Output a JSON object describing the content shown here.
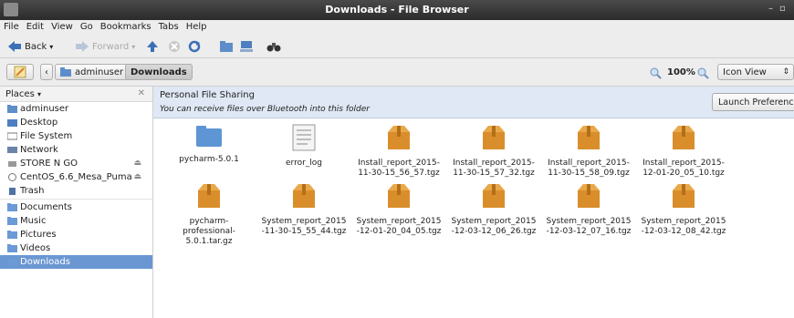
{
  "window": {
    "title": "Downloads - File Browser"
  },
  "menu": [
    "File",
    "Edit",
    "View",
    "Go",
    "Bookmarks",
    "Tabs",
    "Help"
  ],
  "toolbar": {
    "back": "Back",
    "forward": "Forward"
  },
  "location": {
    "crumbs": [
      "adminuser",
      "Downloads"
    ],
    "zoom": "100%",
    "view_mode": "Icon View"
  },
  "sidebar": {
    "header": "Places",
    "places": [
      {
        "label": "adminuser",
        "icon": "home-folder"
      },
      {
        "label": "Desktop",
        "icon": "desktop-folder"
      },
      {
        "label": "File System",
        "icon": "filesystem"
      },
      {
        "label": "Network",
        "icon": "network"
      },
      {
        "label": "STORE N GO",
        "icon": "usb-drive"
      },
      {
        "label": "CentOS_6.6_Mesa_Puma",
        "icon": "disc"
      },
      {
        "label": "Trash",
        "icon": "trash"
      }
    ],
    "bookmarks": [
      {
        "label": "Documents",
        "icon": "folder"
      },
      {
        "label": "Music",
        "icon": "folder"
      },
      {
        "label": "Pictures",
        "icon": "folder"
      },
      {
        "label": "Videos",
        "icon": "folder"
      },
      {
        "label": "Downloads",
        "icon": "folder",
        "selected": true
      }
    ]
  },
  "infobar": {
    "title": "Personal File Sharing",
    "message": "You can receive files over Bluetooth into this folder",
    "button": "Launch Preferences"
  },
  "files": [
    {
      "name": "pycharm-5.0.1",
      "type": "folder"
    },
    {
      "name": "error_log",
      "type": "text"
    },
    {
      "name": "Install_report_2015-11-30-15_56_57.tgz",
      "type": "archive"
    },
    {
      "name": "Install_report_2015-11-30-15_57_32.tgz",
      "type": "archive"
    },
    {
      "name": "Install_report_2015-11-30-15_58_09.tgz",
      "type": "archive"
    },
    {
      "name": "Install_report_2015-12-01-20_05_10.tgz",
      "type": "archive"
    },
    {
      "name": "pycharm-professional-5.0.1.tar.gz",
      "type": "archive"
    },
    {
      "name": "System_report_2015-11-30-15_55_44.tgz",
      "type": "archive"
    },
    {
      "name": "System_report_2015-12-01-20_04_05.tgz",
      "type": "archive"
    },
    {
      "name": "System_report_2015-12-03-12_06_26.tgz",
      "type": "archive"
    },
    {
      "name": "System_report_2015-12-03-12_07_16.tgz",
      "type": "archive"
    },
    {
      "name": "System_report_2015-12-03-12_08_42.tgz",
      "type": "archive"
    }
  ]
}
